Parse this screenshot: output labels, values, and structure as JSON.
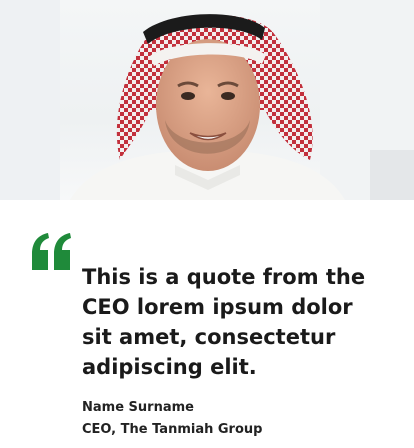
{
  "hero": {
    "image_alt": "Smiling man wearing a red and white checkered keffiyeh"
  },
  "testimonial": {
    "quote_icon": "quote-icon",
    "quote_color": "#1f8a3a",
    "quote": "This is a quote from the CEO lorem ipsum dolor sit amet, consectetur adipiscing elit.",
    "name": "Name Surname",
    "role": "CEO, The Tanmiah Group"
  }
}
